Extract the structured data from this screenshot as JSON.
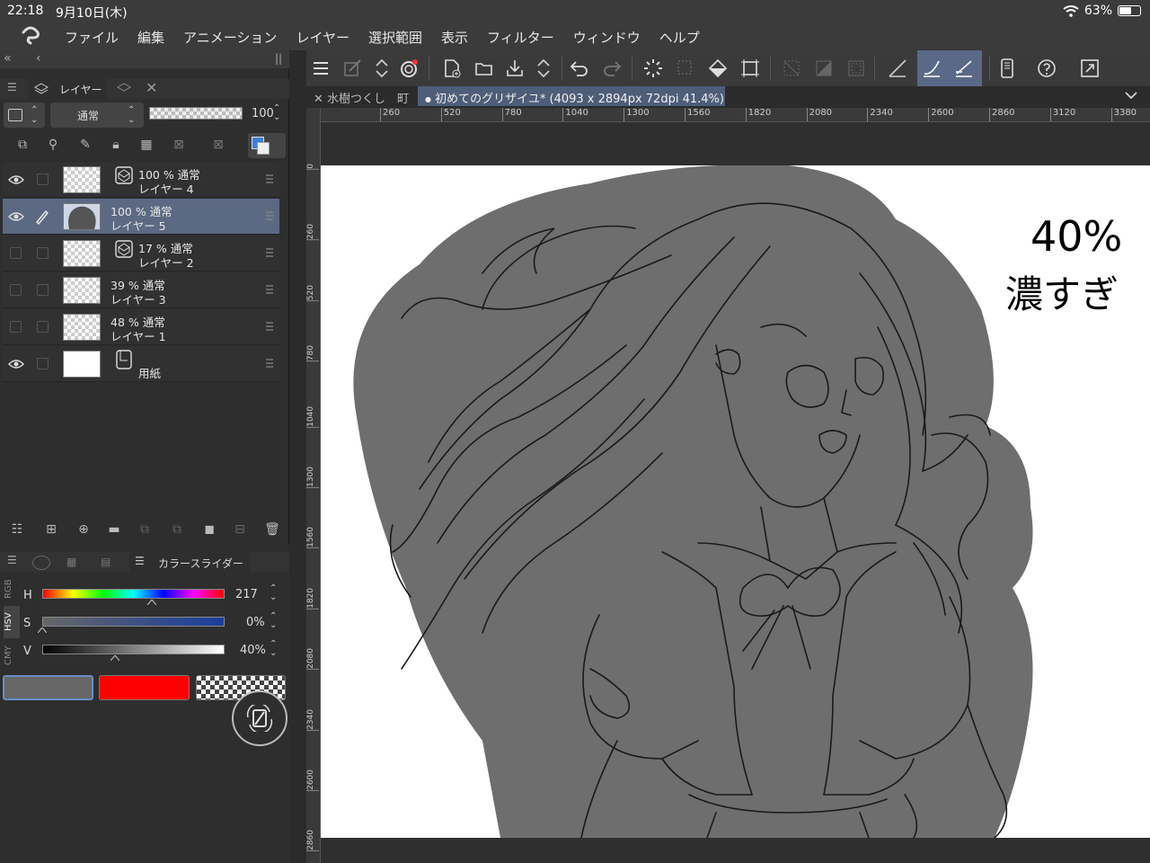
{
  "status": {
    "time": "22:18",
    "date": "9月10日(木)",
    "battery": "63%",
    "battery_level": 0.63
  },
  "menu": [
    "ファイル",
    "編集",
    "アニメーション",
    "レイヤー",
    "選択範囲",
    "表示",
    "フィルター",
    "ウィンドウ",
    "ヘルプ"
  ],
  "layer_panel": {
    "tab_label": "レイヤー",
    "blend_mode": "通常",
    "opacity_value": "100",
    "layers": [
      {
        "opacity": "100 % 通常",
        "name": "レイヤー 4",
        "visible": true,
        "selected": false,
        "thumb": "transparent",
        "kind_icon": "vector"
      },
      {
        "opacity": "100 % 通常",
        "name": "レイヤー 5",
        "visible": true,
        "selected": true,
        "thumb": "silhouette",
        "kind_icon": ""
      },
      {
        "opacity": "17 % 通常",
        "name": "レイヤー 2",
        "visible": false,
        "selected": false,
        "thumb": "transparent",
        "kind_icon": "vector"
      },
      {
        "opacity": "39 % 通常",
        "name": "レイヤー 3",
        "visible": false,
        "selected": false,
        "thumb": "transparent",
        "kind_icon": ""
      },
      {
        "opacity": "48 % 通常",
        "name": "レイヤー 1",
        "visible": false,
        "selected": false,
        "thumb": "transparent",
        "kind_icon": ""
      },
      {
        "opacity": "",
        "name": "用紙",
        "visible": true,
        "selected": false,
        "thumb": "white",
        "kind_icon": "paper"
      }
    ]
  },
  "color_panel": {
    "tab_label": "カラースライダー",
    "modes": [
      "RGB",
      "HSV",
      "CMY"
    ],
    "sliders": [
      {
        "label": "H",
        "value": "217",
        "fraction": 0.6
      },
      {
        "label": "S",
        "value": "0%",
        "fraction": 0.0
      },
      {
        "label": "V",
        "value": "40%",
        "fraction": 0.4
      }
    ],
    "main_color": "#666666",
    "sub_color": "#ff0000"
  },
  "document_tabs": [
    {
      "label": "水樹つくし　町",
      "active": false
    },
    {
      "label": "初めてのグリザイユ* (4093 x 2894px 72dpi 41.4%)",
      "active": true
    }
  ],
  "rulers": {
    "horizontal": [
      "260",
      "520",
      "780",
      "1040",
      "1300",
      "1560",
      "1820",
      "2080",
      "2340",
      "2600",
      "2860",
      "3120",
      "3380"
    ],
    "vertical": [
      "0",
      "260",
      "520",
      "780",
      "1040",
      "1300",
      "1560",
      "1820",
      "2080",
      "2340",
      "2600",
      "2860"
    ]
  },
  "canvas": {
    "note_line1": "40%",
    "note_line2": "濃すぎ",
    "fill_color": "#6e6e6e"
  }
}
